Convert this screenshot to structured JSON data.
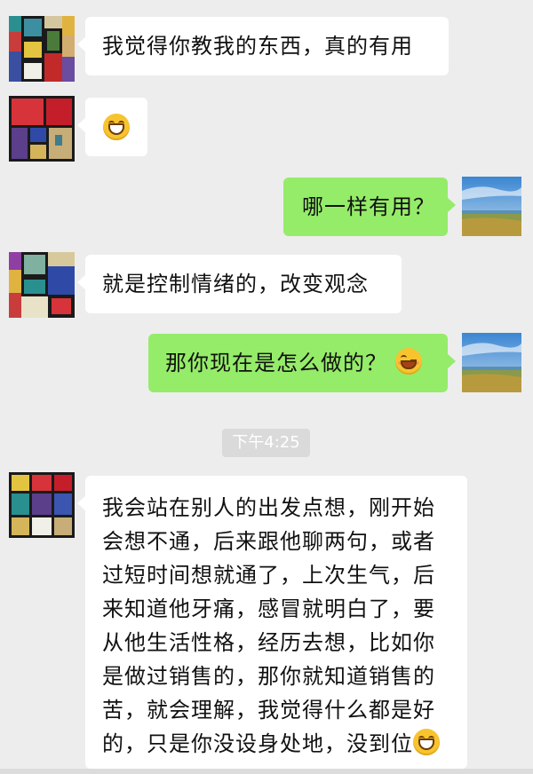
{
  "messages": [
    {
      "side": "left",
      "text": "我觉得你教我的东西，真的有用"
    },
    {
      "side": "left",
      "emoji": "grinning-face-icon"
    },
    {
      "side": "right",
      "text": "哪一样有用？"
    },
    {
      "side": "left",
      "text": "就是控制情绪的，改变观念"
    },
    {
      "side": "right",
      "text": "那你现在是怎么做的？",
      "emoji": "smirking-face-icon"
    },
    {
      "side": "left",
      "lines": [
        "我会站在别人的出发点想，刚开始",
        "会想不通，后来跟他聊两句，或者",
        "过短时间想就通了，上次生气，后",
        "来知道他牙痛，感冒就明白了，要",
        "从他生活性格，经历去想，比如你",
        "是做过销售的，那你就知道销售的",
        "苦，就会理解，我觉得什么都是好",
        "的，只是你没设身处地，没到位"
      ],
      "emoji": "grinning-face-icon"
    }
  ],
  "timestamp": "下午4:25",
  "colors": {
    "background": "#ededed",
    "sent_bubble": "#95ec69",
    "received_bubble": "#ffffff"
  }
}
